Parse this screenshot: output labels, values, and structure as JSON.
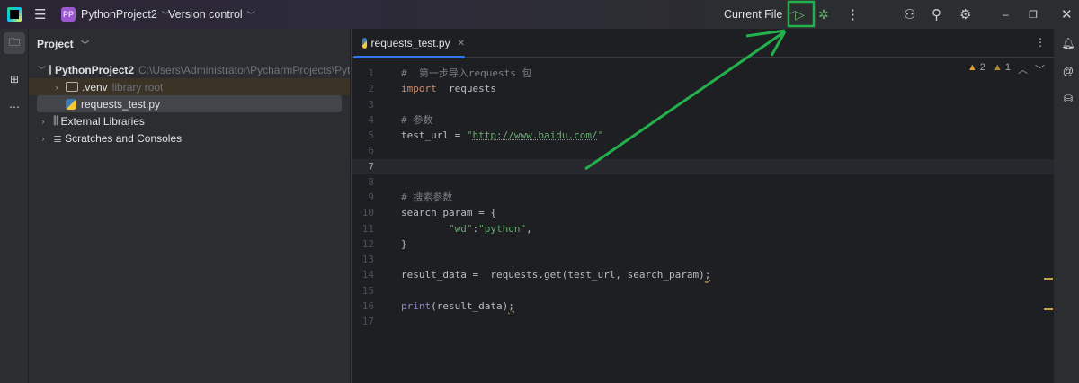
{
  "titlebar": {
    "project_initials": "PP",
    "project_name": "PythonProject2",
    "vcs": "Version control",
    "run_config": "Current File",
    "icons": [
      "main-menu-icon",
      "run-icon",
      "debug-icon",
      "more-icon",
      "add-user-icon",
      "search-icon",
      "settings-icon",
      "minimize-icon",
      "restore-icon",
      "close-icon"
    ]
  },
  "project_panel": {
    "title": "Project",
    "tree": [
      {
        "label": "PythonProject2",
        "extra": "C:\\Users\\Administrator\\PycharmProjects\\PythonProj"
      },
      {
        "label": ".venv",
        "extra": "library root"
      },
      {
        "label": "requests_test.py"
      },
      {
        "label": "External Libraries"
      },
      {
        "label": "Scratches and Consoles"
      }
    ]
  },
  "editor": {
    "tab": "requests_test.py",
    "warnings": "2",
    "weak_warnings": "1",
    "current_line": 7,
    "lines": [
      [
        [
          "t-cm",
          "#  第一步导入requests 包"
        ]
      ],
      [
        [
          "t-kw",
          "import"
        ],
        [
          "t-pl",
          "  requests"
        ]
      ],
      [],
      [
        [
          "t-cm",
          "# 参数"
        ]
      ],
      [
        [
          "t-pl",
          "test_url = "
        ],
        [
          "t-str",
          "\""
        ],
        [
          "t-url",
          "http://www.baidu.com/"
        ],
        [
          "t-str",
          "\""
        ]
      ],
      [],
      [],
      [],
      [
        [
          "t-cm",
          "# 搜索参数"
        ]
      ],
      [
        [
          "t-pl",
          "search_param = {"
        ]
      ],
      [
        [
          "t-pl",
          "        "
        ],
        [
          "t-str",
          "\"wd\""
        ],
        [
          "t-pl",
          ":"
        ],
        [
          "t-str",
          "\"python\""
        ],
        [
          "t-pl",
          ","
        ]
      ],
      [
        [
          "t-pl",
          "}"
        ]
      ],
      [],
      [
        [
          "t-pl",
          "result_data =  requests.get(test_url, search_param)"
        ],
        [
          "t-warn",
          ";"
        ]
      ],
      [],
      [
        [
          "t-fn",
          "print"
        ],
        [
          "t-pl",
          "(result_data)"
        ],
        [
          "t-warn",
          ";"
        ]
      ],
      []
    ]
  },
  "colors": {
    "accent": "#3574f0",
    "annotation": "#22b14c"
  }
}
